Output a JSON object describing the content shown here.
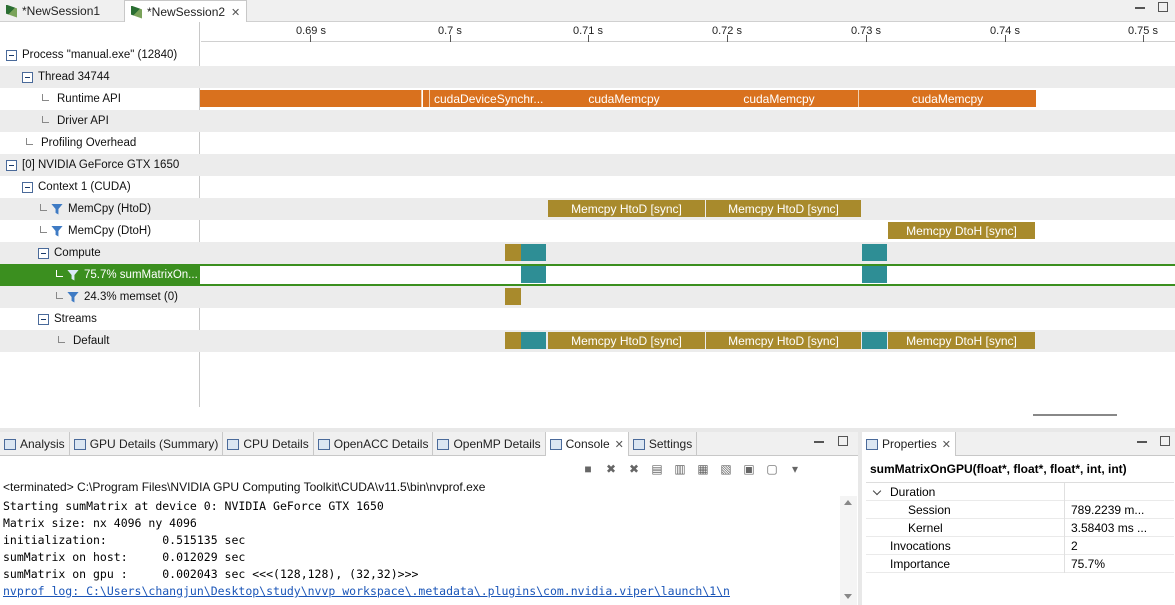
{
  "editor_tabs": [
    {
      "label": "*NewSession1"
    },
    {
      "label": "*NewSession2"
    }
  ],
  "ruler": {
    "ticks": [
      "0.69 s",
      "0.7 s",
      "0.71 s",
      "0.72 s",
      "0.73 s",
      "0.74 s",
      "0.75 s"
    ]
  },
  "timeline": {
    "rows": [
      {
        "label": "Process \"manual.exe\" (12840)"
      },
      {
        "label": "Thread 34744"
      },
      {
        "label": "Runtime API"
      },
      {
        "label": "Driver API"
      },
      {
        "label": "Profiling Overhead"
      },
      {
        "label": "[0] NVIDIA GeForce GTX 1650"
      },
      {
        "label": "Context 1 (CUDA)"
      },
      {
        "label": "MemCpy (HtoD)"
      },
      {
        "label": "MemCpy (DtoH)"
      },
      {
        "label": "Compute"
      },
      {
        "label": "75.7% sumMatrixOn..."
      },
      {
        "label": "24.3% memset (0)"
      },
      {
        "label": "Streams"
      },
      {
        "label": "Default"
      }
    ],
    "bars": {
      "runtime_1": "cudaDeviceSynchr...",
      "runtime_2": "cudaMemcpy",
      "runtime_3": "cudaMemcpy",
      "runtime_4": "cudaMemcpy",
      "htod_1": "Memcpy HtoD [sync]",
      "htod_2": "Memcpy HtoD [sync]",
      "dtoh_1": "Memcpy DtoH [sync]",
      "def_htod_1": "Memcpy HtoD [sync]",
      "def_htod_2": "Memcpy HtoD [sync]",
      "def_dtoh_1": "Memcpy DtoH [sync]"
    }
  },
  "bottom_tabs": [
    {
      "label": "Analysis"
    },
    {
      "label": "GPU Details (Summary)"
    },
    {
      "label": "CPU Details"
    },
    {
      "label": "OpenACC Details"
    },
    {
      "label": "OpenMP Details"
    },
    {
      "label": "Console"
    },
    {
      "label": "Settings"
    }
  ],
  "console": {
    "terminated_line": "<terminated> C:\\Program Files\\NVIDIA GPU Computing Toolkit\\CUDA\\v11.5\\bin\\nvprof.exe",
    "lines": [
      "Starting sumMatrix at device 0: NVIDIA GeForce GTX 1650",
      "Matrix size: nx 4096 ny 4096",
      "initialization:        0.515135 sec",
      "sumMatrix on host:     0.012029 sec",
      "sumMatrix on gpu :     0.002043 sec <<<(128,128), (32,32)>>>"
    ],
    "log_link": "nvprof log: C:\\Users\\changjun\\Desktop\\study\\nvvp workspace\\.metadata\\.plugins\\com.nvidia.viper\\launch\\1\\n"
  },
  "properties": {
    "tab_label": "Properties",
    "title": "sumMatrixOnGPU(float*, float*, float*, int, int)",
    "rows": [
      {
        "key": "Duration",
        "value": ""
      },
      {
        "key": "Session",
        "value": "789.2239 m..."
      },
      {
        "key": "Kernel",
        "value": "3.58403 ms ..."
      },
      {
        "key": "Invocations",
        "value": "2"
      },
      {
        "key": "Importance",
        "value": "75.7%"
      }
    ]
  }
}
